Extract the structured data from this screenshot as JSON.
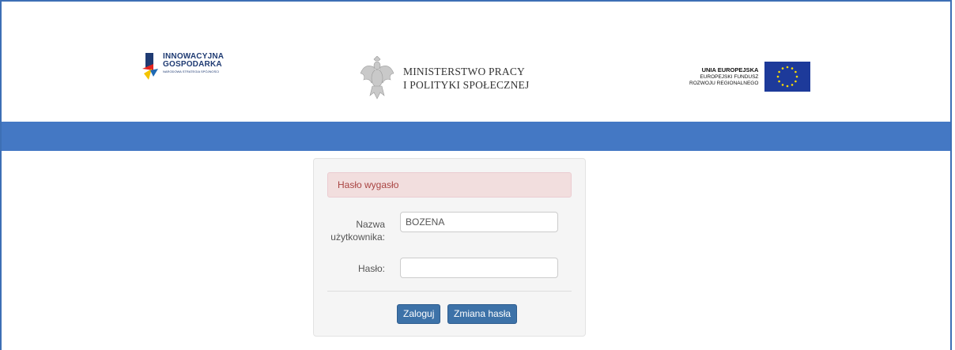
{
  "header": {
    "logo_left": {
      "line1": "INNOWACYJNA",
      "line2": "GOSPODARKA",
      "line3": "NARODOWA STRATEGIA SPÓJNOŚCI"
    },
    "logo_center": {
      "line1": "MINISTERSTWO PRACY",
      "line2": "I POLITYKI SPOŁECZNEJ"
    },
    "logo_right": {
      "line1": "UNIA EUROPEJSKA",
      "line2": "EUROPEJSKI FUNDUSZ",
      "line3": "ROZWOJU REGIONALNEGO"
    }
  },
  "colors": {
    "bar": "#4478c4",
    "alert_text": "#a94442",
    "alert_bg": "#f2dede",
    "button": "#3d72a8"
  },
  "login": {
    "alert": "Hasło wygasło",
    "username_label_1": "Nazwa",
    "username_label_2": "użytkownika:",
    "username_value": "BOZENA",
    "password_label": "Hasło:",
    "password_value": "",
    "login_button": "Zaloguj",
    "change_password_button": "Zmiana hasła"
  }
}
